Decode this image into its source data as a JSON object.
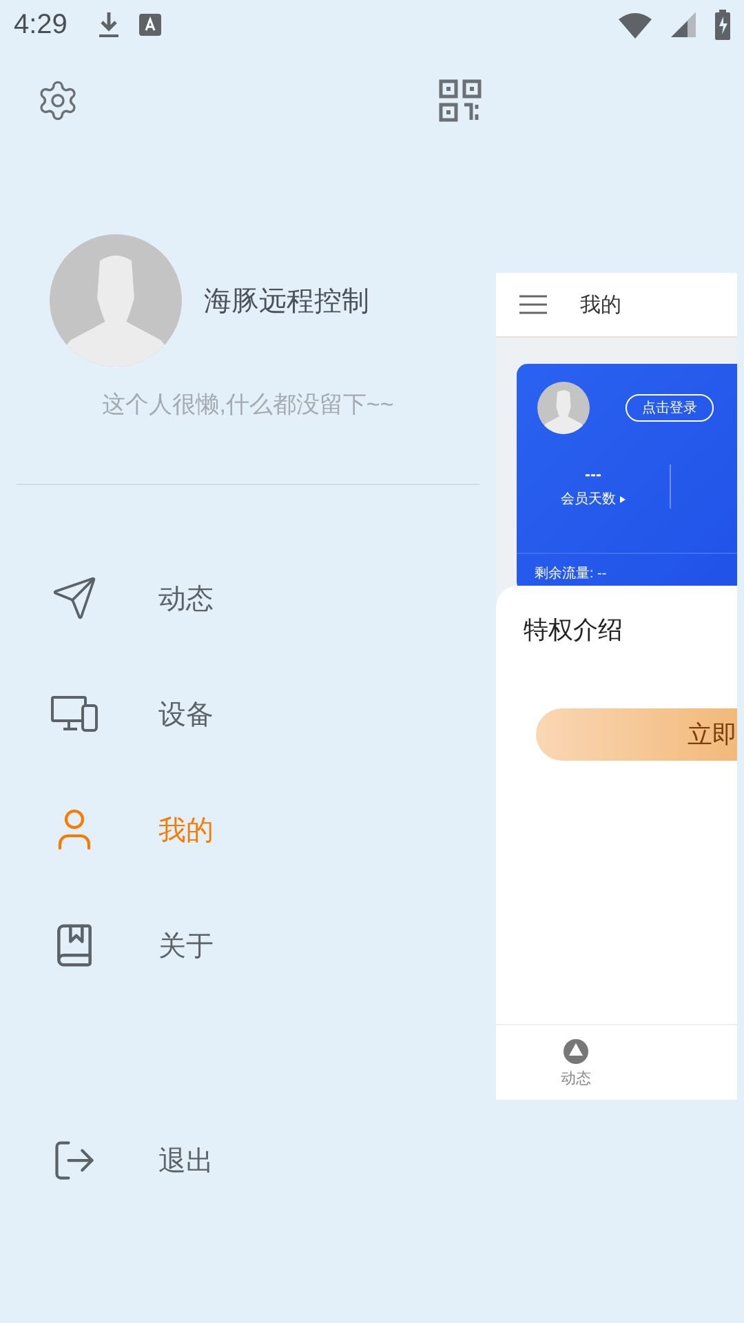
{
  "status_bar": {
    "time": "4:29"
  },
  "drawer": {
    "user_name": "海豚远程控制",
    "signature": "这个人很懒,什么都没留下~~",
    "menu": [
      {
        "label": "动态",
        "kind": "send",
        "selected": false
      },
      {
        "label": "设备",
        "kind": "devices",
        "selected": false
      },
      {
        "label": "我的",
        "kind": "user",
        "selected": true
      },
      {
        "label": "关于",
        "kind": "book",
        "selected": false
      }
    ],
    "logout": {
      "label": "退出"
    }
  },
  "preview": {
    "title": "我的",
    "login": "点击登录",
    "stat": {
      "value": "---",
      "label": "会员天数"
    },
    "traffic": "剩余流量: --",
    "section_title": "特权介绍",
    "action": "立即",
    "tabs": [
      {
        "label": "动态"
      }
    ]
  }
}
